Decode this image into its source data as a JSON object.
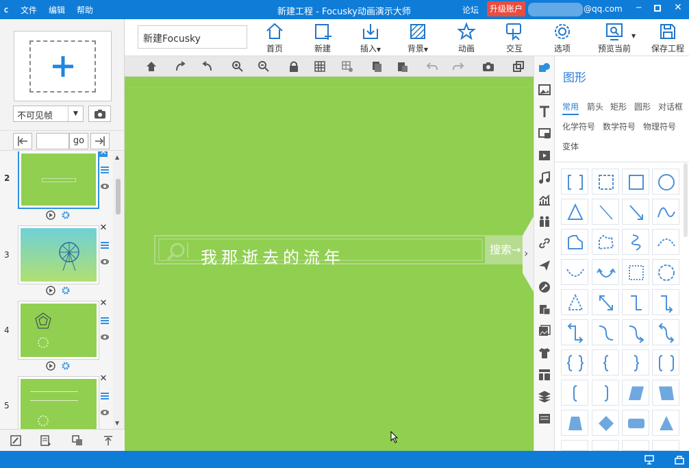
{
  "titlebar": {
    "menus": [
      "文件",
      "编辑",
      "帮助"
    ],
    "title": "新建工程 - Focusky动画演示大师",
    "forum": "论坛",
    "upgrade": "升级账户",
    "email": "@qq.com"
  },
  "ribbon": {
    "doc_name": "新建Focusky",
    "buttons": [
      {
        "label": "首页",
        "icon": "home-icon"
      },
      {
        "label": "新建",
        "icon": "new-icon"
      },
      {
        "label": "插入",
        "icon": "insert-icon",
        "dropdown": true
      },
      {
        "label": "背景",
        "icon": "background-icon",
        "dropdown": true
      },
      {
        "label": "动画",
        "icon": "animation-icon"
      },
      {
        "label": "交互",
        "icon": "interaction-icon"
      },
      {
        "label": "选项",
        "icon": "options-icon"
      },
      {
        "label": "预览当前",
        "icon": "preview-icon",
        "dropdown": true
      },
      {
        "label": "保存工程",
        "icon": "save-icon"
      }
    ]
  },
  "left": {
    "frame_select": "不可见帧",
    "go_label": "go",
    "page_input": "",
    "slides": [
      {
        "num": "2",
        "selected": true
      },
      {
        "num": "3",
        "selected": false
      },
      {
        "num": "4",
        "selected": false
      },
      {
        "num": "5",
        "selected": false
      }
    ]
  },
  "canvas": {
    "search_text": "我那逝去的流年",
    "search_button": "搜索→"
  },
  "right": {
    "title": "图形",
    "categories": [
      "常用",
      "箭头",
      "矩形",
      "圆形",
      "对话框",
      "化学符号",
      "数学符号",
      "物理符号",
      "变体"
    ],
    "active_category": "常用"
  },
  "colors": {
    "accent": "#0f7cd8",
    "canvas_bg": "#90cf50",
    "upgrade": "#e94d3f"
  }
}
